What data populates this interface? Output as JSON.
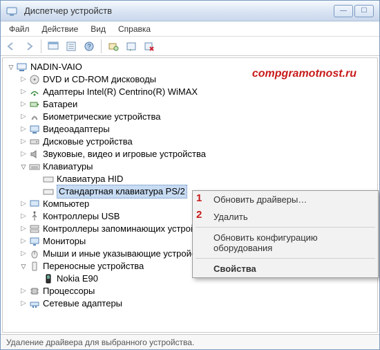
{
  "window": {
    "title": "Диспетчер устройств"
  },
  "menu": {
    "file": "Файл",
    "action": "Действие",
    "view": "Вид",
    "help": "Справка"
  },
  "watermark": "compgramotnost.ru",
  "tree": {
    "root": "NADIN-VAIO",
    "items": [
      "DVD и CD-ROM дисководы",
      "Адаптеры Intel(R) Centrino(R) WiMAX",
      "Батареи",
      "Биометрические устройства",
      "Видеоадаптеры",
      "Дисковые устройства",
      "Звуковые, видео и игровые устройства"
    ],
    "keyboards": {
      "label": "Клавиатуры",
      "children": [
        "Клавиатура HID",
        "Стандартная клавиатура PS/2"
      ],
      "selected_index": 1
    },
    "after": [
      "Компьютер",
      "Контроллеры USB",
      "Контроллеры запоминающих устройств",
      "Мониторы",
      "Мыши и иные указывающие устройства"
    ],
    "portable": {
      "label": "Переносные устройства",
      "children": [
        "Nokia E90"
      ]
    },
    "tail": [
      "Процессоры",
      "Сетевые адаптеры"
    ]
  },
  "context_menu": {
    "update": "Обновить драйверы…",
    "delete": "Удалить",
    "refresh_cfg": "Обновить конфигурацию оборудования",
    "properties": "Свойства"
  },
  "callouts": {
    "one": "1",
    "two": "2"
  },
  "status": "Удаление драйвера для выбранного устройства."
}
